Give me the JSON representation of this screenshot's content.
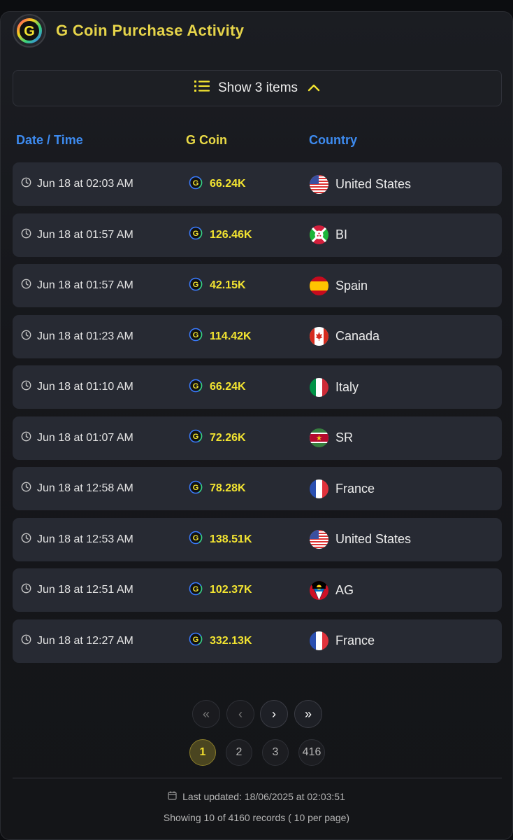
{
  "header": {
    "title": "G Coin Purchase Activity",
    "logo_icon": "g-coin-logo-icon"
  },
  "toggle": {
    "label": "Show 3 items",
    "icon": "list-icon",
    "chevron": "chevron-up-icon"
  },
  "columns": {
    "date": "Date / Time",
    "coin": "G Coin",
    "country": "Country"
  },
  "rows": [
    {
      "date": "Jun 18 at 02:03 AM",
      "coin": "66.24K",
      "country": "United States",
      "flag": "us"
    },
    {
      "date": "Jun 18 at 01:57 AM",
      "coin": "126.46K",
      "country": "BI",
      "flag": "bi"
    },
    {
      "date": "Jun 18 at 01:57 AM",
      "coin": "42.15K",
      "country": "Spain",
      "flag": "es"
    },
    {
      "date": "Jun 18 at 01:23 AM",
      "coin": "114.42K",
      "country": "Canada",
      "flag": "ca"
    },
    {
      "date": "Jun 18 at 01:10 AM",
      "coin": "66.24K",
      "country": "Italy",
      "flag": "it"
    },
    {
      "date": "Jun 18 at 01:07 AM",
      "coin": "72.26K",
      "country": "SR",
      "flag": "sr"
    },
    {
      "date": "Jun 18 at 12:58 AM",
      "coin": "78.28K",
      "country": "France",
      "flag": "fr"
    },
    {
      "date": "Jun 18 at 12:53 AM",
      "coin": "138.51K",
      "country": "United States",
      "flag": "us"
    },
    {
      "date": "Jun 18 at 12:51 AM",
      "coin": "102.37K",
      "country": "AG",
      "flag": "ag"
    },
    {
      "date": "Jun 18 at 12:27 AM",
      "coin": "332.13K",
      "country": "France",
      "flag": "fr"
    }
  ],
  "pagination": {
    "first": "«",
    "prev": "‹",
    "next": "›",
    "last": "»",
    "pages": [
      "1",
      "2",
      "3",
      "416"
    ],
    "current": "1"
  },
  "footer": {
    "last_updated": "Last updated: 18/06/2025 at 02:03:51",
    "records": "Showing 10 of 4160 records ( 10 per page)"
  },
  "colors": {
    "accent_yellow": "#f3e431",
    "accent_blue": "#3d8bf0",
    "row_bg": "#272a33"
  }
}
